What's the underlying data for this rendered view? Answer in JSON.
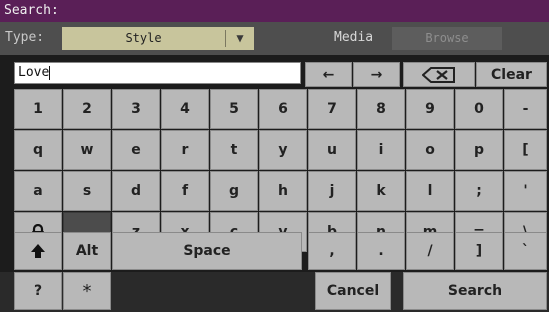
{
  "title": "Search:",
  "type_label": "Type:",
  "type_value": "Style",
  "media_label": "Media",
  "browse_label": "Browse",
  "search_value": "Love",
  "nav": {
    "left": "←",
    "right": "→",
    "clear": "Clear"
  },
  "rows": [
    [
      "1",
      "2",
      "3",
      "4",
      "5",
      "6",
      "7",
      "8",
      "9",
      "0",
      "-"
    ],
    [
      "q",
      "w",
      "e",
      "r",
      "t",
      "y",
      "u",
      "i",
      "o",
      "p",
      "["
    ],
    [
      "a",
      "s",
      "d",
      "f",
      "g",
      "h",
      "j",
      "k",
      "l",
      ";",
      "'"
    ],
    [
      "z",
      "x",
      "c",
      "v",
      "b",
      "n",
      "m",
      "=",
      "\\"
    ],
    [
      "Alt",
      "Space",
      ",",
      ".",
      "/",
      "]",
      "`"
    ],
    [
      "?",
      "*"
    ]
  ],
  "bottom": {
    "cancel": "Cancel",
    "search": "Search"
  },
  "icons": {
    "lock": "lock-icon",
    "shift": "shift-arrow-icon",
    "backspace": "backspace-icon"
  },
  "colors": {
    "title_bar": "#5a1f57",
    "type_field": "#c8c59c",
    "key": "#b8b8b8"
  }
}
